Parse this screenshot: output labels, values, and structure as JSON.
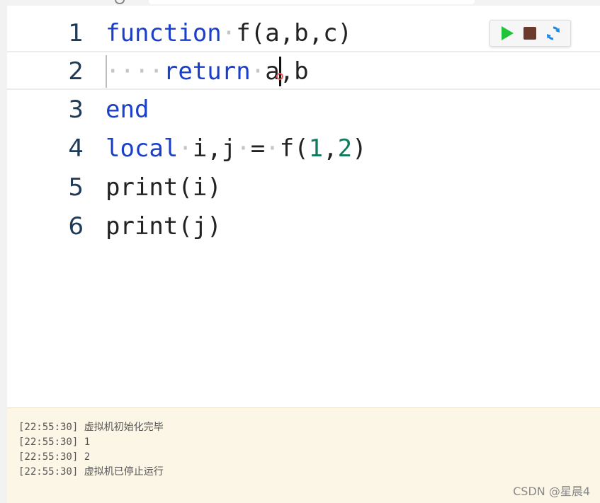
{
  "editor": {
    "line_numbers": [
      "1",
      "2",
      "3",
      "4",
      "5",
      "6"
    ],
    "current_line": 2,
    "colors": {
      "keyword": "#1a3fc8",
      "number": "#0f7a5c",
      "whitespace_marker": "#c4c4c4"
    },
    "lines": [
      [
        {
          "type": "kw",
          "text": "function"
        },
        {
          "type": "ws",
          "text": "·"
        },
        {
          "type": "plain",
          "text": "f(a,b,c)"
        }
      ],
      [
        {
          "type": "ws",
          "text": "····"
        },
        {
          "type": "kw",
          "text": "return"
        },
        {
          "type": "ws",
          "text": "·"
        },
        {
          "type": "plain",
          "text": "a,b"
        }
      ],
      [
        {
          "type": "kw",
          "text": "end"
        }
      ],
      [
        {
          "type": "kw",
          "text": "local"
        },
        {
          "type": "ws",
          "text": "·"
        },
        {
          "type": "plain",
          "text": "i,j"
        },
        {
          "type": "ws",
          "text": "·"
        },
        {
          "type": "plain",
          "text": "="
        },
        {
          "type": "ws",
          "text": "·"
        },
        {
          "type": "plain",
          "text": "f("
        },
        {
          "type": "num",
          "text": "1"
        },
        {
          "type": "plain",
          "text": ","
        },
        {
          "type": "num",
          "text": "2"
        },
        {
          "type": "plain",
          "text": ")"
        }
      ],
      [
        {
          "type": "plain",
          "text": "print(i)"
        }
      ],
      [
        {
          "type": "plain",
          "text": "print(j)"
        }
      ]
    ]
  },
  "toolbar": {
    "run_icon": "play-icon",
    "stop_icon": "stop-icon",
    "refresh_icon": "refresh-icon",
    "run_color": "#1fc43a",
    "stop_color": "#6b3a2c",
    "refresh_color": "#1e88e5"
  },
  "console": {
    "logs": [
      "[22:55:30] 虚拟机初始化完毕",
      "[22:55:30] 1",
      "[22:55:30] 2",
      "[22:55:30] 虚拟机已停止运行"
    ],
    "background": "#fbf6e6"
  },
  "watermark": {
    "text": "CSDN @星晨4"
  }
}
